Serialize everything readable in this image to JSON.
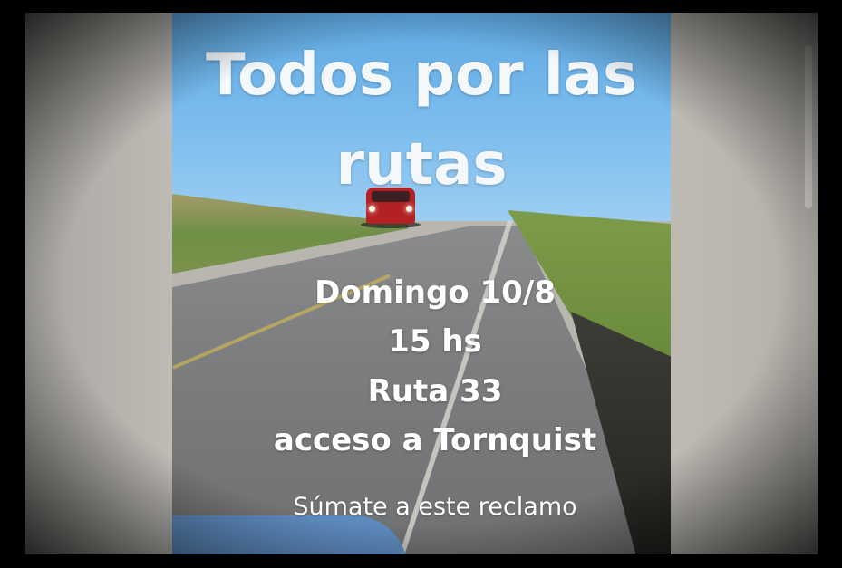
{
  "poster": {
    "title_line1": "Todos por las",
    "title_line2": "rutas",
    "date": "Domingo 10/8",
    "time": "15 hs",
    "route": "Ruta 33",
    "place": "acceso a Tornquist",
    "call_to_action": "Súmate a este reclamo"
  },
  "colors": {
    "sky": "#7cbdee",
    "road": "#7c7e80",
    "car": "#b32124",
    "text": "#ffffff",
    "frame": "#b9b6b0"
  },
  "icons": {
    "scrollbar": "scrollbar-thumb"
  }
}
